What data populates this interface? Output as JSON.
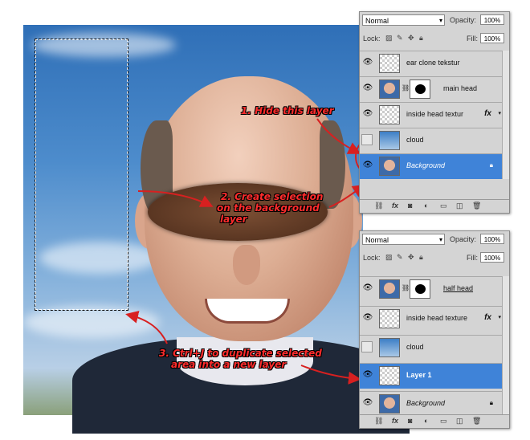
{
  "annotations": {
    "step1": "1. Hide this layer",
    "step2_line1": "2. Create selection",
    "step2_line2": "on the background",
    "step2_line3": "layer",
    "step3_line1": "3. Ctrl+J to duplicate selected",
    "step3_line2": "area into a new layer"
  },
  "panel_top": {
    "blend_mode": "Normal",
    "opacity_label": "Opacity:",
    "opacity_value": "100%",
    "lock_label": "Lock:",
    "fill_label": "Fill:",
    "fill_value": "100%",
    "layers": [
      {
        "name": "ear clone tekstur",
        "visible": true,
        "selected": false
      },
      {
        "name": "main head",
        "visible": true,
        "selected": false
      },
      {
        "name": "inside head textur",
        "visible": true,
        "selected": false,
        "fx": "fx"
      },
      {
        "name": "cloud",
        "visible": false,
        "selected": false
      },
      {
        "name": "Background",
        "visible": true,
        "selected": true
      }
    ]
  },
  "panel_bottom": {
    "blend_mode": "Normal",
    "opacity_label": "Opacity:",
    "opacity_value": "100%",
    "lock_label": "Lock:",
    "fill_label": "Fill:",
    "fill_value": "100%",
    "layers": [
      {
        "name": "half head",
        "visible": true,
        "selected": false
      },
      {
        "name": "inside head texture",
        "visible": true,
        "selected": false,
        "fx": "fx"
      },
      {
        "name": "cloud",
        "visible": false,
        "selected": false
      },
      {
        "name": "Layer 1",
        "visible": true,
        "selected": true
      },
      {
        "name": "Background",
        "visible": true,
        "selected": false
      }
    ]
  },
  "colors": {
    "annotation": "#ff2c2c",
    "selected_layer": "#3f83d8"
  }
}
